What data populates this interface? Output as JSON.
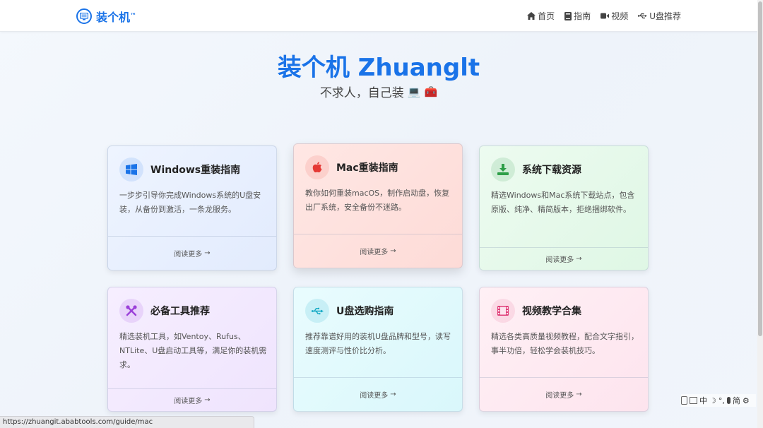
{
  "header": {
    "brand_name": "装个机",
    "brand_tm": "™",
    "nav": [
      {
        "label": "首页",
        "icon": "home-icon"
      },
      {
        "label": "指南",
        "icon": "book-icon"
      },
      {
        "label": "视频",
        "icon": "video-icon"
      },
      {
        "label": "U盘推荐",
        "icon": "usb-icon"
      }
    ]
  },
  "hero": {
    "title": "装个机 Zhuanglt",
    "subtitle": "不求人，自己装",
    "emoji_1": "💻",
    "emoji_2": "🧰"
  },
  "cards": [
    {
      "title": "Windows重装指南",
      "desc": "一步步引导你完成Windows系统的U盘安装，从备份到激活，一条龙服务。",
      "link": "阅读更多",
      "icon": "windows-icon",
      "color": "#1a73e8"
    },
    {
      "title": "Mac重装指南",
      "desc": "教你如何重装macOS，制作启动盘，恢复出厂系统，安全备份不迷路。",
      "link": "阅读更多",
      "icon": "apple-icon",
      "color": "#e53935"
    },
    {
      "title": "系统下载资源",
      "desc": "精选Windows和Mac系统下载站点，包含原版、纯净、精简版本，拒绝捆绑软件。",
      "link": "阅读更多",
      "icon": "download-icon",
      "color": "#2e9e48"
    },
    {
      "title": "必备工具推荐",
      "desc": "精选装机工具，如Ventoy、Rufus、NTLite、U盘启动工具等，满足你的装机需求。",
      "link": "阅读更多",
      "icon": "tools-icon",
      "color": "#9b40d9"
    },
    {
      "title": "U盘选购指南",
      "desc": "推荐靠谱好用的装机U盘品牌和型号，读写速度测评与性价比分析。",
      "link": "阅读更多",
      "icon": "usb-icon",
      "color": "#11a8c4"
    },
    {
      "title": "视频教学合集",
      "desc": "精选各类高质量视频教程，配合文字指引，事半功倍，轻松学会装机技巧。",
      "link": "阅读更多",
      "icon": "film-icon",
      "color": "#e0407a"
    }
  ],
  "status_bar": {
    "url": "https://zhuangit.ababtools.com/guide/mac"
  },
  "ime": {
    "lang": "中",
    "mode": "简"
  }
}
